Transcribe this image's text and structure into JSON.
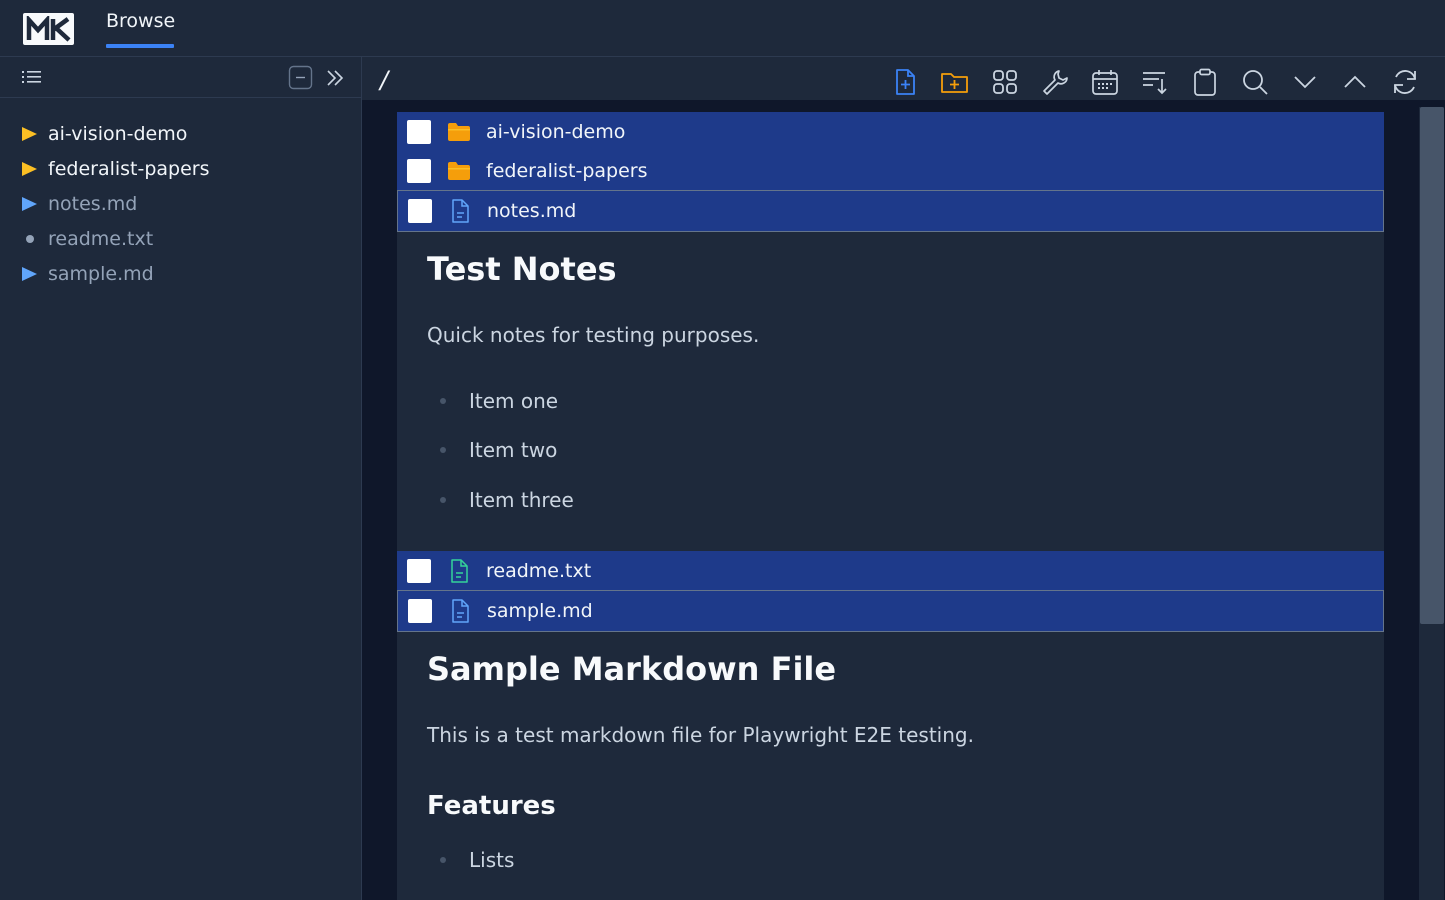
{
  "app": {
    "logo_text": "MK",
    "tab_label": "Browse"
  },
  "sidebar": {
    "items": [
      {
        "label": "ai-vision-demo",
        "kind": "folder"
      },
      {
        "label": "federalist-papers",
        "kind": "folder"
      },
      {
        "label": "notes.md",
        "kind": "file-md"
      },
      {
        "label": "readme.txt",
        "kind": "file-txt"
      },
      {
        "label": "sample.md",
        "kind": "file-md"
      }
    ]
  },
  "main": {
    "path": "/",
    "toolbar": {
      "icons": [
        "new-file-icon",
        "new-folder-icon",
        "grid-view-icon",
        "wrench-icon",
        "calendar-icon",
        "sort-icon",
        "clipboard-icon",
        "search-icon",
        "chevron-down-icon",
        "chevron-up-icon",
        "refresh-icon"
      ]
    },
    "rows": [
      {
        "label": "ai-vision-demo",
        "icon": "folder-icon"
      },
      {
        "label": "federalist-papers",
        "icon": "folder-icon"
      },
      {
        "label": "notes.md",
        "icon": "file-md-icon"
      },
      {
        "label": "readme.txt",
        "icon": "file-txt-icon"
      },
      {
        "label": "sample.md",
        "icon": "file-md-icon"
      }
    ],
    "notes_preview": {
      "title": "Test Notes",
      "paragraph": "Quick notes for testing purposes.",
      "items": [
        "Item one",
        "Item two",
        "Item three"
      ]
    },
    "sample_preview": {
      "title": "Sample Markdown File",
      "paragraph": "This is a test markdown file for Playwright E2E testing.",
      "features_heading": "Features",
      "items": [
        "Lists"
      ]
    }
  },
  "colors": {
    "accent": "#3b82f6",
    "folder": "#fbbf24",
    "md_file": "#60a5fa",
    "txt_file": "#34d399",
    "row_bg": "#1e3a8a",
    "panel_bg": "#1e293b",
    "outer_bg": "#0f172a"
  }
}
